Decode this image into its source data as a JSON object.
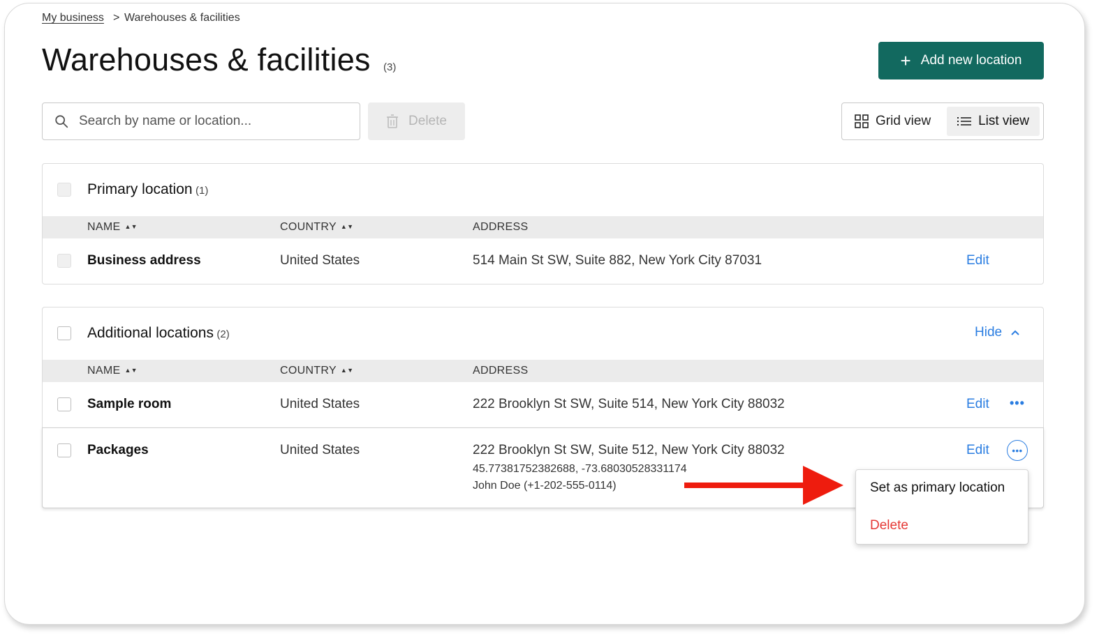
{
  "breadcrumb": {
    "parent": "My business",
    "separator": ">",
    "current": "Warehouses & facilities"
  },
  "page": {
    "title": "Warehouses & facilities",
    "count": "(3)"
  },
  "toolbar": {
    "add_label": "Add new location",
    "search_placeholder": "Search by name or location...",
    "delete_label": "Delete",
    "grid_view_label": "Grid view",
    "list_view_label": "List view"
  },
  "columns": {
    "name": "NAME",
    "country": "COUNTRY",
    "address": "ADDRESS"
  },
  "primary": {
    "title": "Primary location",
    "count": "(1)",
    "rows": [
      {
        "name": "Business address",
        "country": "United States",
        "address": "514 Main St SW, Suite 882, New York City 87031",
        "edit": "Edit"
      }
    ]
  },
  "additional": {
    "title": "Additional locations",
    "count": "(2)",
    "hide_label": "Hide",
    "rows": [
      {
        "name": "Sample room",
        "country": "United States",
        "address": "222 Brooklyn St SW, Suite 514, New York City 88032",
        "edit": "Edit",
        "more": "•••"
      },
      {
        "name": "Packages",
        "country": "United States",
        "address": "222 Brooklyn St SW, Suite 512, New York City 88032",
        "coords": "45.77381752382688, -73.68030528331174",
        "contact": "John Doe (+1-202-555-0114)",
        "edit": "Edit",
        "more": "•••"
      }
    ]
  },
  "menu": {
    "set_primary": "Set as primary location",
    "delete": "Delete"
  },
  "colors": {
    "brand": "#12695f",
    "link": "#2a7de1",
    "danger": "#e53935",
    "arrow": "#ee1c0e"
  }
}
